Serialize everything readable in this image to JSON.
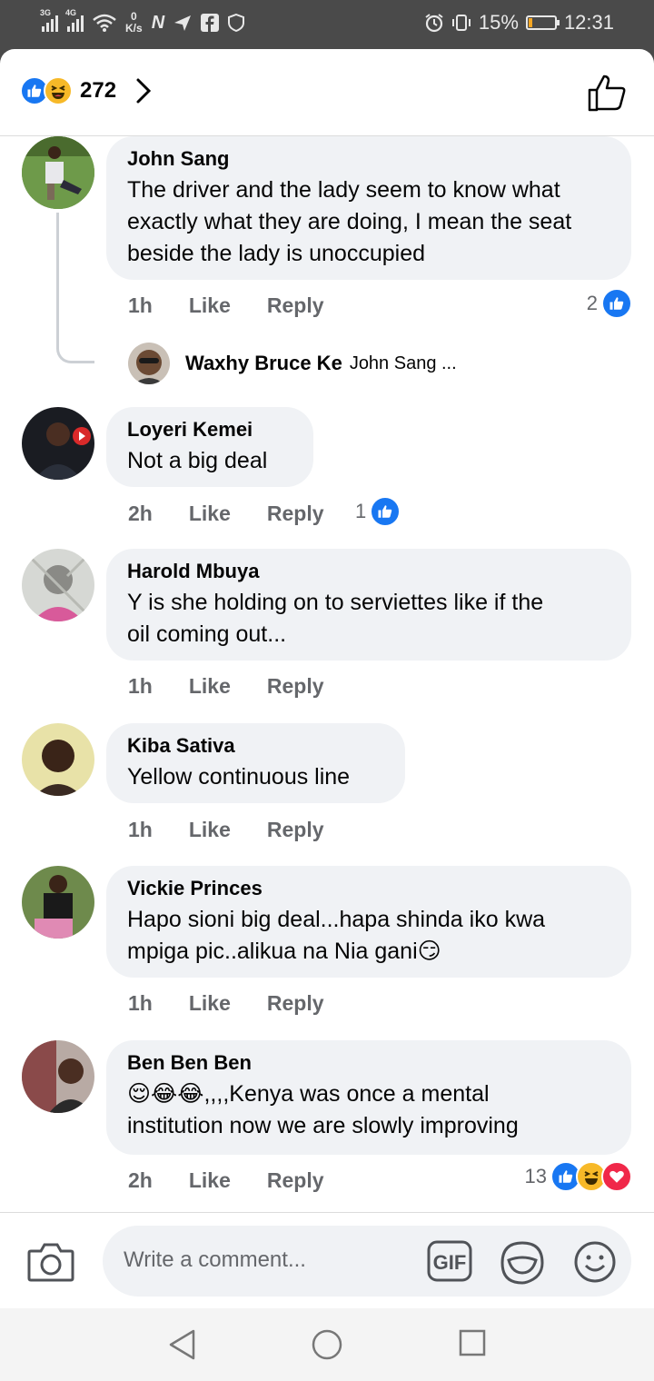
{
  "status_bar": {
    "net1": "3G",
    "net2": "4G",
    "speed_value": "0",
    "speed_unit": "K/s",
    "battery_percent": "15%",
    "battery_level": 0.15,
    "time": "12:31",
    "icons": [
      "signal-icon",
      "wifi-icon",
      "n-icon",
      "send-icon",
      "facebook-icon",
      "alarm-icon",
      "vibrate-icon",
      "battery-icon"
    ]
  },
  "header": {
    "reactions": [
      "like",
      "haha"
    ],
    "reaction_count": "272"
  },
  "comments": [
    {
      "name": "John Sang",
      "lines": [
        "The driver and the lady seem to know what",
        "exactly what they are doing, I mean the seat",
        "beside the lady is unoccupied"
      ],
      "time": "1h",
      "like_label": "Like",
      "reply_label": "Reply",
      "reaction_count": "2",
      "reply": {
        "name": "Waxhy Bruce Ke",
        "snippet": "John Sang ..."
      }
    },
    {
      "name": "Loyeri Kemei",
      "lines": [
        "Not a big deal"
      ],
      "time": "2h",
      "like_label": "Like",
      "reply_label": "Reply",
      "reaction_count": "1"
    },
    {
      "name": "Harold Mbuya",
      "lines": [
        "Y is she holding on to serviettes like if the",
        "oil coming out..."
      ],
      "time": "1h",
      "like_label": "Like",
      "reply_label": "Reply"
    },
    {
      "name": "Kiba Sativa",
      "lines": [
        "Yellow continuous line"
      ],
      "time": "1h",
      "like_label": "Like",
      "reply_label": "Reply"
    },
    {
      "name": "Vickie Princes",
      "lines": [
        "Hapo sioni big deal...hapa shinda iko kwa",
        "mpiga pic..alikua na Nia gani😏"
      ],
      "time": "1h",
      "like_label": "Like",
      "reply_label": "Reply"
    },
    {
      "name": "Ben Ben Ben",
      "lines": [
        "😌😂😂,,,,Kenya was once a mental",
        "institution now we are slowly improving"
      ],
      "time": "2h",
      "like_label": "Like",
      "reply_label": "Reply",
      "reaction_count": "13"
    }
  ],
  "composer": {
    "placeholder": "Write a comment...",
    "gif_label": "GIF"
  },
  "colors": {
    "like_blue": "#1877f2",
    "haha_yellow": "#f7b928",
    "love_red": "#f02849",
    "bubble_bg": "#f0f2f5",
    "meta_gray": "#65676b"
  }
}
